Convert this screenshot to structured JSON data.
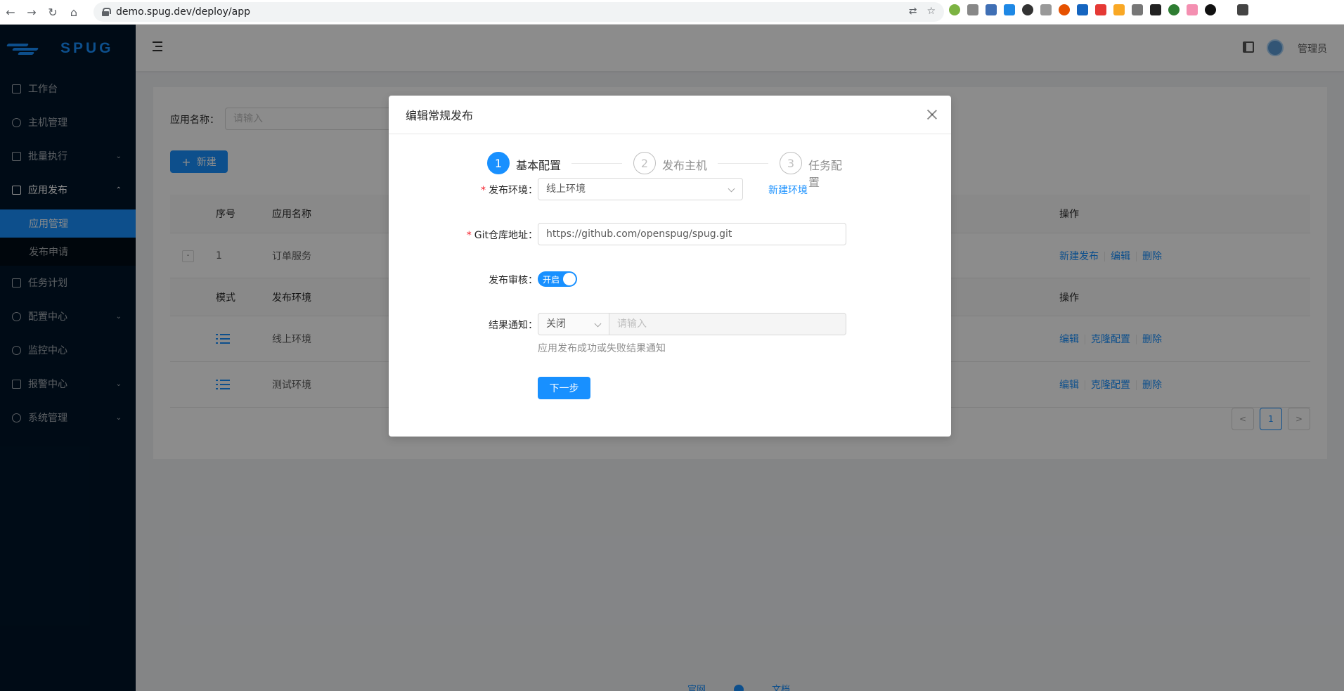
{
  "browser": {
    "url": "demo.spug.dev/deploy/app"
  },
  "sidebar": {
    "logo_text": "SPUG",
    "items": [
      {
        "label": "工作台",
        "icon": "desktop-icon"
      },
      {
        "label": "主机管理",
        "icon": "cloud-server-icon"
      },
      {
        "label": "批量执行",
        "icon": "code-icon"
      },
      {
        "label": "应用发布",
        "icon": "flag-icon"
      },
      {
        "label": "任务计划",
        "icon": "schedule-icon"
      },
      {
        "label": "配置中心",
        "icon": "deployment-unit-icon"
      },
      {
        "label": "监控中心",
        "icon": "monitor-icon"
      },
      {
        "label": "报警中心",
        "icon": "alert-icon"
      },
      {
        "label": "系统管理",
        "icon": "setting-icon"
      }
    ],
    "sub_items": [
      {
        "label": "应用管理"
      },
      {
        "label": "发布申请"
      }
    ]
  },
  "header": {
    "user_name": "管理员"
  },
  "content": {
    "search_label": "应用名称：",
    "search_placeholder": "请输入",
    "new_button": "新建",
    "table": {
      "columns": [
        "序号",
        "应用名称",
        "操作"
      ],
      "row": {
        "index": "1",
        "name": "订单服务",
        "actions": [
          "新建发布",
          "编辑",
          "删除"
        ]
      },
      "sub_columns": [
        "模式",
        "发布环境",
        "操作"
      ],
      "sub_rows": [
        {
          "env": "线上环境",
          "actions": [
            "编辑",
            "克隆配置",
            "删除"
          ]
        },
        {
          "env": "测试环境",
          "actions": [
            "编辑",
            "克隆配置",
            "删除"
          ]
        }
      ]
    },
    "pagination": {
      "current": "1"
    }
  },
  "footer": {
    "links": [
      "官网",
      "文档"
    ]
  },
  "modal": {
    "title": "编辑常规发布",
    "steps": [
      {
        "num": "1",
        "title": "基本配置",
        "status": "active"
      },
      {
        "num": "2",
        "title": "发布主机",
        "status": "wait"
      },
      {
        "num": "3",
        "title": "任务配置",
        "status": "wait"
      }
    ],
    "form": {
      "env_label": "发布环境：",
      "env_value": "线上环境",
      "new_env_link": "新建环境",
      "git_label": "Git仓库地址：",
      "git_value": "https://github.com/openspug/spug.git",
      "audit_label": "发布审核：",
      "audit_switch_text": "开启",
      "notify_label": "结果通知：",
      "notify_select": "关闭",
      "notify_placeholder": "请输入",
      "notify_help": "应用发布成功或失败结果通知",
      "next_button": "下一步"
    }
  },
  "colors": {
    "primary": "#1890ff",
    "sidebar_bg": "#001529",
    "required": "#f5222d"
  }
}
